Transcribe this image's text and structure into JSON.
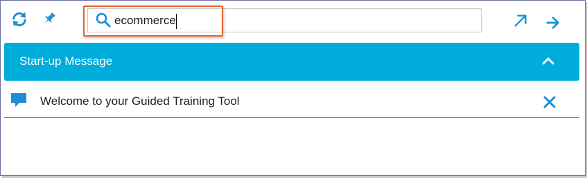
{
  "toolbar": {
    "refresh_icon": "refresh-icon",
    "pin_icon": "pin-icon",
    "expand_icon": "expand-arrow-icon",
    "forward_icon": "arrow-right-icon"
  },
  "search": {
    "value": "ecommerce",
    "icon": "search-icon",
    "highlight_color": "#e0642c"
  },
  "panel": {
    "title": "Start-up Message",
    "collapse_icon": "chevron-up-icon",
    "header_color": "#00acd9"
  },
  "message": {
    "icon": "chat-bubble-icon",
    "text": "Welcome to your Guided Training Tool",
    "close_icon": "close-icon"
  },
  "colors": {
    "accent": "#00acd9",
    "icon_blue": "#1a8fd6",
    "highlight": "#e0642c"
  }
}
